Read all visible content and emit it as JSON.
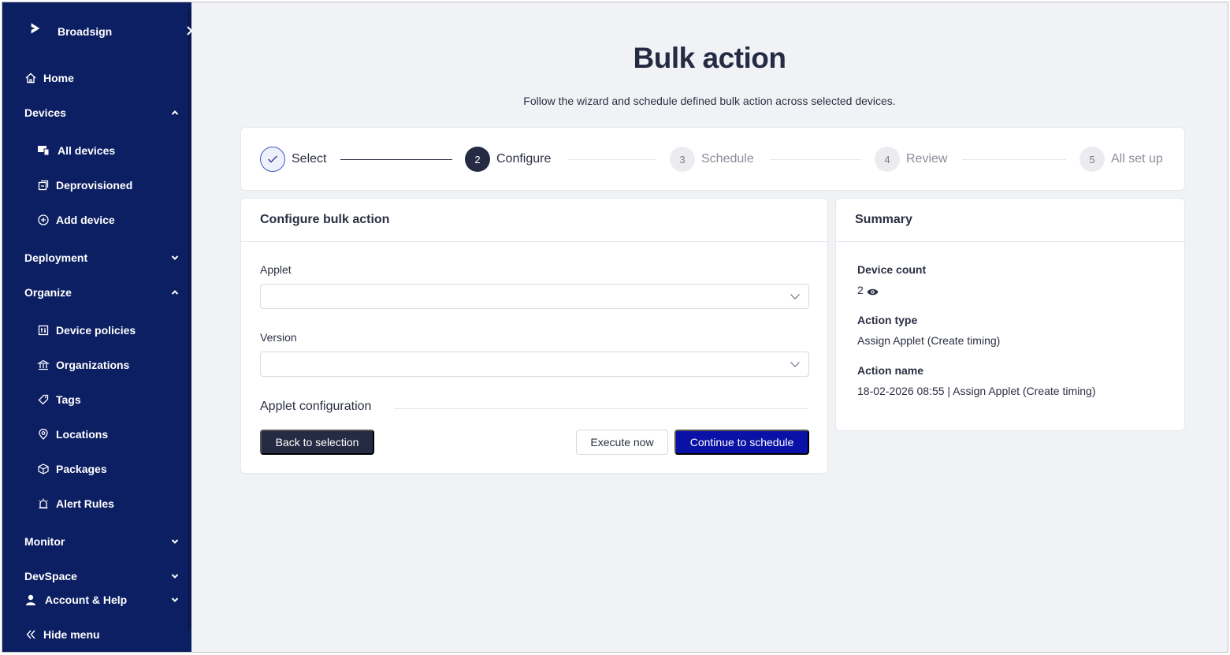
{
  "sidebar": {
    "brand": "Broadsign",
    "home": "Home",
    "devices": {
      "label": "Devices",
      "items": [
        "All devices",
        "Deprovisioned",
        "Add device"
      ]
    },
    "deployment": "Deployment",
    "organize": {
      "label": "Organize",
      "items": [
        "Device policies",
        "Organizations",
        "Tags",
        "Locations",
        "Packages",
        "Alert Rules"
      ]
    },
    "monitor": "Monitor",
    "devspace": "DevSpace",
    "account": "Account & Help",
    "hide": "Hide menu"
  },
  "page": {
    "title": "Bulk action",
    "subtitle": "Follow the wizard and schedule defined bulk action across selected devices."
  },
  "stepper": {
    "steps": [
      {
        "num": "",
        "label": "Select",
        "state": "done"
      },
      {
        "num": "2",
        "label": "Configure",
        "state": "active"
      },
      {
        "num": "3",
        "label": "Schedule",
        "state": "pending"
      },
      {
        "num": "4",
        "label": "Review",
        "state": "pending"
      },
      {
        "num": "5",
        "label": "All set up",
        "state": "pending"
      }
    ]
  },
  "config": {
    "title": "Configure bulk action",
    "applet_label": "Applet",
    "applet_value": "",
    "version_label": "Version",
    "version_value": "",
    "applet_config_label": "Applet configuration",
    "back_label": "Back to selection",
    "execute_label": "Execute now",
    "continue_label": "Continue to schedule"
  },
  "summary": {
    "title": "Summary",
    "device_count_label": "Device count",
    "device_count": "2",
    "action_type_label": "Action type",
    "action_type": "Assign Applet (Create timing)",
    "action_name_label": "Action name",
    "action_name": "18-02-2026 08:55 | Assign Applet (Create timing)"
  },
  "colors": {
    "sidebar_bg": "#0d1f63",
    "primary": "#0a11a6",
    "dark": "#252b43",
    "page_bg": "#f1f2f6"
  }
}
